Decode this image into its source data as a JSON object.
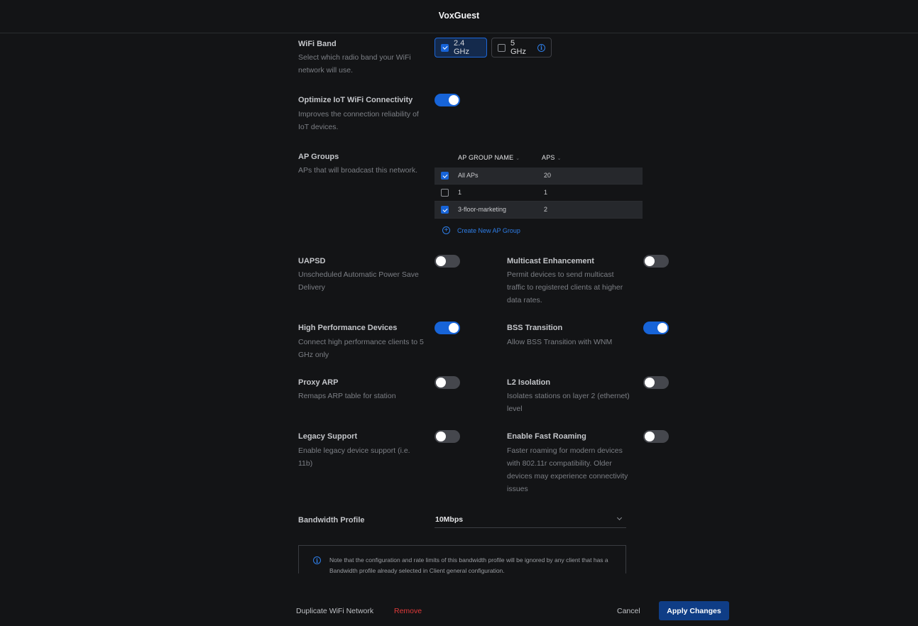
{
  "header": {
    "title": "VoxGuest"
  },
  "wifi_band": {
    "label": "WiFi Band",
    "desc": "Select which radio band your WiFi network will use.",
    "options": [
      {
        "label": "2.4 GHz",
        "checked": true
      },
      {
        "label": "5 GHz",
        "checked": false
      }
    ]
  },
  "iot": {
    "label": "Optimize IoT WiFi Connectivity",
    "desc": "Improves the connection reliability of IoT devices.",
    "on": true
  },
  "ap_groups": {
    "label": "AP Groups",
    "desc": "APs that will broadcast this network.",
    "columns": [
      "AP GROUP NAME",
      "APS"
    ],
    "rows": [
      {
        "name": "All APs",
        "aps": "20",
        "checked": true
      },
      {
        "name": "1",
        "aps": "1",
        "checked": false
      },
      {
        "name": "3-floor-marketing",
        "aps": "2",
        "checked": true
      }
    ],
    "create_label": "Create New AP Group"
  },
  "settings": {
    "uapsd": {
      "label": "UAPSD",
      "desc": "Unscheduled Automatic Power Save Delivery",
      "on": false
    },
    "multicast": {
      "label": "Multicast Enhancement",
      "desc": "Permit devices to send multicast traffic to registered clients at higher data rates.",
      "on": false
    },
    "high_perf": {
      "label": "High Performance Devices",
      "desc": "Connect high performance clients to 5 GHz only",
      "on": true
    },
    "bss": {
      "label": "BSS Transition",
      "desc": "Allow BSS Transition with WNM",
      "on": true
    },
    "proxy_arp": {
      "label": "Proxy ARP",
      "desc": "Remaps ARP table for station",
      "on": false
    },
    "l2": {
      "label": "L2 Isolation",
      "desc": "Isolates stations on layer 2 (ethernet) level",
      "on": false
    },
    "legacy": {
      "label": "Legacy Support",
      "desc": "Enable legacy device support (i.e. 11b)",
      "on": false
    },
    "fast_roaming": {
      "label": "Enable Fast Roaming",
      "desc": "Faster roaming for modern devices with 802.11r compatibility. Older devices may experience connectivity issues",
      "on": false
    }
  },
  "bandwidth": {
    "label": "Bandwidth Profile",
    "value": "10Mbps",
    "note": "Note that the configuration and rate limits of this bandwidth profile will be ignored by any client that has a Bandwidth profile already selected in Client general configuration."
  },
  "footer": {
    "duplicate": "Duplicate WiFi Network",
    "remove": "Remove",
    "cancel": "Cancel",
    "apply": "Apply Changes"
  },
  "colors": {
    "accent": "#1764d8",
    "danger": "#e03a3a",
    "background": "#131416"
  }
}
